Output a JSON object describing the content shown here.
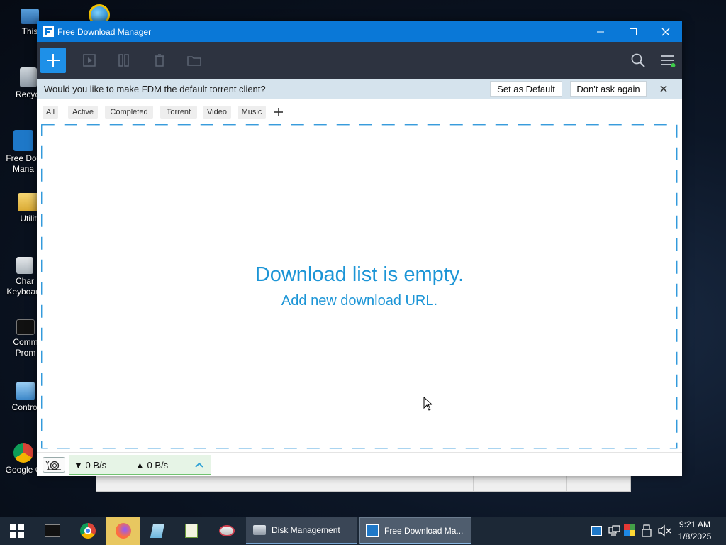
{
  "desktop": {
    "icons": [
      {
        "label": "This"
      },
      {
        "label": "Recycl"
      },
      {
        "label_line1": "Free Dov",
        "label_line2": "Mana"
      },
      {
        "label": "Utilit"
      },
      {
        "label_line1": "Char",
        "label_line2": "Keyboard"
      },
      {
        "label_line1": "Comm",
        "label_line2": "Prom"
      },
      {
        "label": "Control"
      },
      {
        "label": "Google C"
      }
    ]
  },
  "window": {
    "title": "Free Download Manager",
    "infobar": {
      "message": "Would you like to make FDM the default torrent client?",
      "set_default": "Set as Default",
      "dont_ask": "Don't ask again"
    },
    "filters": [
      "All",
      "Active",
      "Completed",
      "Torrent",
      "Video",
      "Music"
    ],
    "empty_title": "Download list is empty.",
    "empty_subtitle": "Add new download URL.",
    "status": {
      "download_speed": "▼ 0 B/s",
      "upload_speed": "▲ 0 B/s"
    }
  },
  "taskbar": {
    "tasks": [
      {
        "label": "Disk Management"
      },
      {
        "label": "Free Download Ma..."
      }
    ],
    "time": "9:21 AM",
    "date": "1/8/2025"
  },
  "colors": {
    "titlebar": "#0a78d7",
    "toolbar": "#2d3340",
    "accent": "#1c95d6",
    "infobar": "#d5e3ed"
  }
}
